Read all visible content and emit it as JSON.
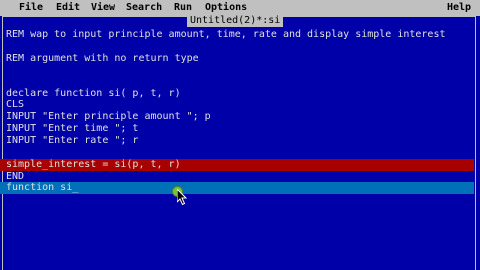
{
  "menubar": {
    "file": "File",
    "edit": "Edit",
    "view": "View",
    "search": "Search",
    "run": "Run",
    "options": "Options",
    "help": "Help"
  },
  "document": {
    "title": "Untitled(2)*:si"
  },
  "editor": {
    "lines": [
      "REM wap to input principle amount, time, rate and display simple interest",
      "",
      "REM argument with no return type",
      "",
      "",
      "declare function si( p, t, r)",
      "CLS",
      "INPUT \"Enter principle amount \"; p",
      "INPUT \"Enter time \"; t",
      "INPUT \"Enter rate \"; r",
      "",
      "simple_interest = si(p, t, r)",
      "END",
      "function si_"
    ]
  },
  "colors": {
    "background": "#0000a8",
    "menubar": "#c0c0c0",
    "text": "#e0e0e0",
    "highlight_red": "#a80000",
    "highlight_cyan": "#0070b8"
  },
  "icons": {
    "cursor": "mouse-pointer-icon",
    "click_indicator": "click-highlight-icon"
  }
}
